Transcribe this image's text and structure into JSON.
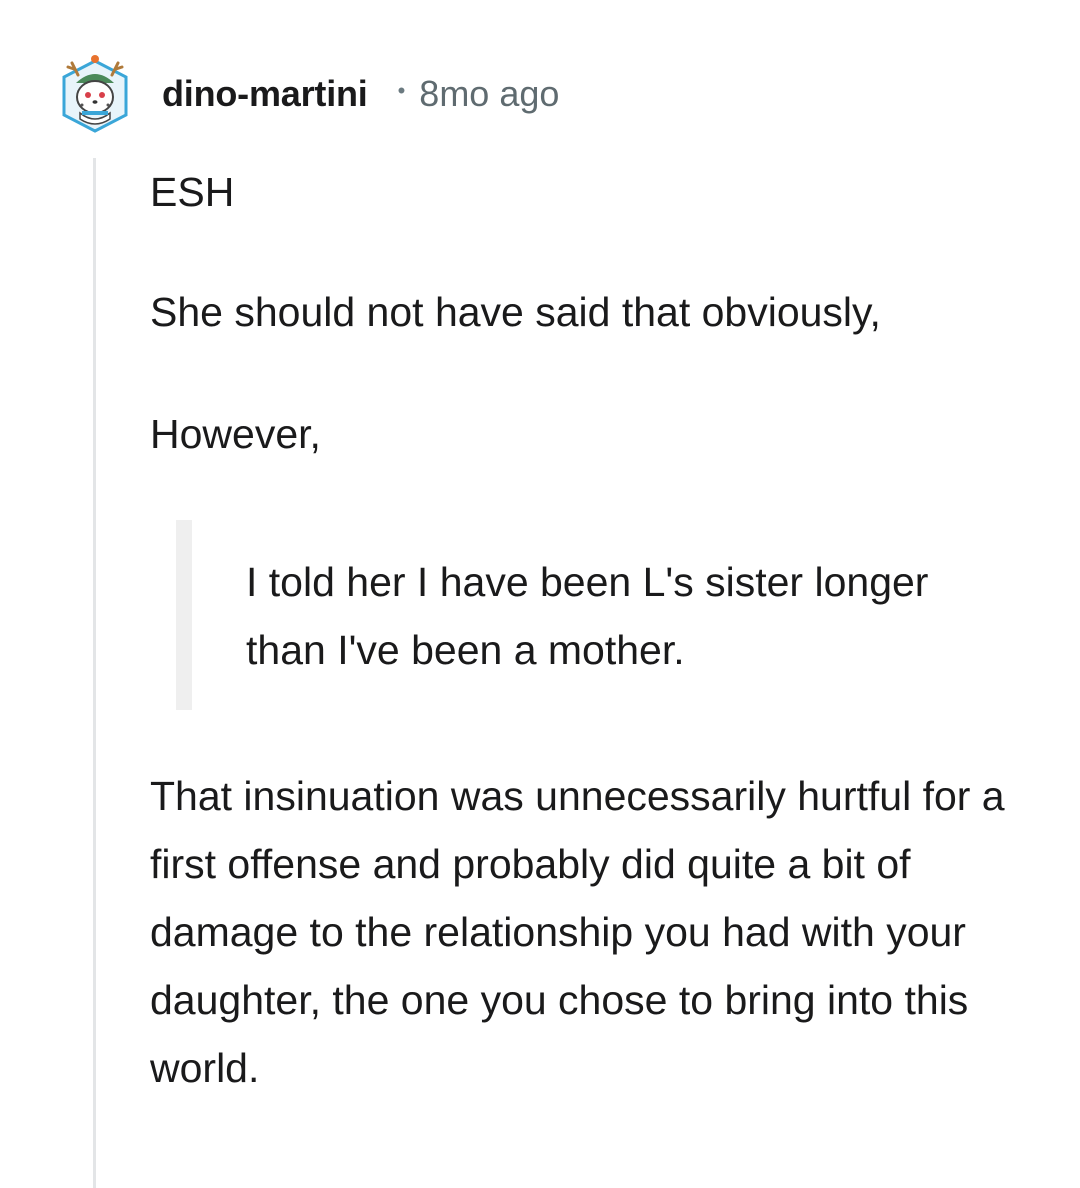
{
  "comment": {
    "author": "dino-martini",
    "separator": "•",
    "timestamp": "8mo ago",
    "avatar_icon": "snow-leopard-antler-avatar-icon",
    "paragraphs": [
      "ESH",
      "She should not have said that obviously,",
      "However,"
    ],
    "quote": "I told her I have been L's sister longer than I've been a mother.",
    "closing_paragraph": "That insinuation was unnecessarily hurtful for a first offense and probably did quite a bit of damage to the relationship you had with your daughter, the one you chose to bring into this world."
  },
  "colors": {
    "text": "#1a1a1b",
    "meta": "#5f6b70",
    "thread_line": "#e3e5e7",
    "quote_bar": "#efefef",
    "avatar_bg": "#3aa6d8"
  }
}
